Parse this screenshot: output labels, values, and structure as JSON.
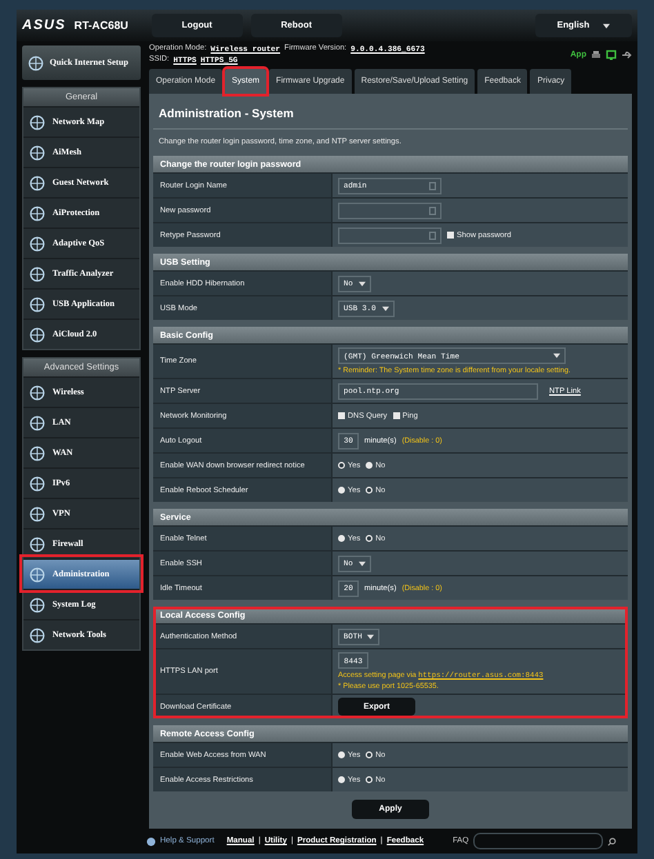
{
  "header": {
    "logo": "ASUS",
    "model": "RT-AC68U",
    "buttons": [
      "Logout",
      "Reboot"
    ],
    "language": "English"
  },
  "info": {
    "mode_label": "Operation Mode:",
    "mode": "Wireless router",
    "firmware_label": "Firmware Version:",
    "firmware": "9.0.0.4.386_6673",
    "ssid_label": "SSID:",
    "ssids": [
      "HTTPS",
      "HTTPS_5G"
    ],
    "app": "App"
  },
  "sidebar": {
    "quick_setup": "Quick Internet Setup",
    "groups": [
      {
        "title": "General",
        "items": [
          {
            "label": "Network Map",
            "selected": false,
            "highlighted": false
          },
          {
            "label": "AiMesh",
            "selected": false,
            "highlighted": false
          },
          {
            "label": "Guest Network",
            "selected": false,
            "highlighted": false
          },
          {
            "label": "AiProtection",
            "selected": false,
            "highlighted": false
          },
          {
            "label": "Adaptive QoS",
            "selected": false,
            "highlighted": false
          },
          {
            "label": "Traffic Analyzer",
            "selected": false,
            "highlighted": false
          },
          {
            "label": "USB Application",
            "selected": false,
            "highlighted": false
          },
          {
            "label": "AiCloud 2.0",
            "selected": false,
            "highlighted": false
          }
        ]
      },
      {
        "title": "Advanced Settings",
        "items": [
          {
            "label": "Wireless",
            "selected": false,
            "highlighted": false
          },
          {
            "label": "LAN",
            "selected": false,
            "highlighted": false
          },
          {
            "label": "WAN",
            "selected": false,
            "highlighted": false
          },
          {
            "label": "IPv6",
            "selected": false,
            "highlighted": false
          },
          {
            "label": "VPN",
            "selected": false,
            "highlighted": false
          },
          {
            "label": "Firewall",
            "selected": false,
            "highlighted": false
          },
          {
            "label": "Administration",
            "selected": true,
            "highlighted": true
          },
          {
            "label": "System Log",
            "selected": false,
            "highlighted": false
          },
          {
            "label": "Network Tools",
            "selected": false,
            "highlighted": false
          }
        ]
      }
    ]
  },
  "tabs": [
    {
      "label": "Operation Mode",
      "selected": false,
      "highlighted": false
    },
    {
      "label": "System",
      "selected": true,
      "highlighted": true
    },
    {
      "label": "Firmware Upgrade",
      "selected": false,
      "highlighted": false
    },
    {
      "label": "Restore/Save/Upload Setting",
      "selected": false,
      "highlighted": false
    },
    {
      "label": "Feedback",
      "selected": false,
      "highlighted": false
    },
    {
      "label": "Privacy",
      "selected": false,
      "highlighted": false
    }
  ],
  "page": {
    "title": "Administration - System",
    "description": "Change the router login password, time zone, and NTP server settings."
  },
  "sections": [
    {
      "title": "Change the router login password",
      "highlighted": false,
      "rows": [
        {
          "label": "Router Login Name",
          "kind": "input",
          "value": "admin"
        },
        {
          "label": "New password",
          "kind": "input"
        },
        {
          "label": "Retype Password",
          "kind": "input",
          "checkbox": {
            "label": "Show password",
            "checked": false
          }
        }
      ]
    },
    {
      "title": "USB Setting",
      "highlighted": false,
      "rows": [
        {
          "label": "Enable HDD Hibernation",
          "kind": "select",
          "value": "No"
        },
        {
          "label": "USB Mode",
          "kind": "select",
          "value": "USB 3.0"
        }
      ]
    },
    {
      "title": "Basic Config",
      "highlighted": false,
      "rows": [
        {
          "label": "Time Zone",
          "kind": "wideselect",
          "value": "(GMT) Greenwich Mean Time",
          "note": "* Reminder: The System time zone is different from your locale setting."
        },
        {
          "label": "NTP Server",
          "kind": "text",
          "value": "pool.ntp.org",
          "link": "NTP Link"
        },
        {
          "label": "Network Monitoring",
          "kind": "checks",
          "options": [
            {
              "label": "DNS Query",
              "checked": false
            },
            {
              "label": "Ping",
              "checked": false
            }
          ]
        },
        {
          "label": "Auto Logout",
          "kind": "number",
          "value": "30",
          "suffix": "minute(s)",
          "hint": "(Disable : 0)"
        },
        {
          "label": "Enable WAN down browser redirect notice",
          "kind": "radio",
          "options": [
            {
              "label": "Yes",
              "selected": true
            },
            {
              "label": "No",
              "selected": false
            }
          ]
        },
        {
          "label": "Enable Reboot Scheduler",
          "kind": "radio",
          "options": [
            {
              "label": "Yes",
              "selected": false
            },
            {
              "label": "No",
              "selected": true
            }
          ]
        }
      ]
    },
    {
      "title": "Service",
      "highlighted": false,
      "rows": [
        {
          "label": "Enable Telnet",
          "kind": "radio",
          "options": [
            {
              "label": "Yes",
              "selected": false
            },
            {
              "label": "No",
              "selected": true
            }
          ]
        },
        {
          "label": "Enable SSH",
          "kind": "select",
          "value": "No"
        },
        {
          "label": "Idle Timeout",
          "kind": "number",
          "value": "20",
          "suffix": "minute(s)",
          "hint": "(Disable : 0)"
        }
      ]
    },
    {
      "title": "Local Access Config",
      "highlighted": true,
      "rows": [
        {
          "label": "Authentication Method",
          "kind": "select",
          "value": "BOTH"
        },
        {
          "label": "HTTPS LAN port",
          "kind": "port",
          "value": "8443",
          "text": "Access setting page via",
          "link": "https://router.asus.com:8443",
          "note": "* Please use port 1025-65535."
        },
        {
          "label": "Download Certificate",
          "kind": "button",
          "value": "Export"
        }
      ]
    },
    {
      "title": "Remote Access Config",
      "highlighted": false,
      "rows": [
        {
          "label": "Enable Web Access from WAN",
          "kind": "radio",
          "options": [
            {
              "label": "Yes",
              "selected": false
            },
            {
              "label": "No",
              "selected": true
            }
          ]
        },
        {
          "label": "Enable Access Restrictions",
          "kind": "radio",
          "options": [
            {
              "label": "Yes",
              "selected": false
            },
            {
              "label": "No",
              "selected": true
            }
          ]
        }
      ]
    }
  ],
  "apply": "Apply",
  "footer": {
    "help": "Help & Support",
    "links": [
      "Manual",
      "Utility",
      "Product Registration",
      "Feedback"
    ],
    "separators": [
      "|",
      "|",
      "|"
    ],
    "faq": "FAQ"
  }
}
